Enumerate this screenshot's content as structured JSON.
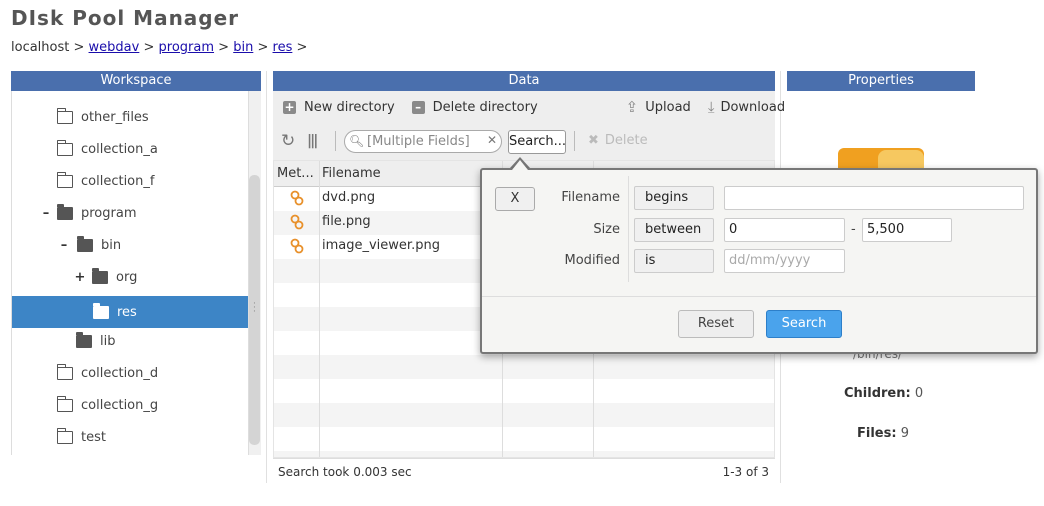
{
  "app": {
    "title": "DIsk Pool Manager"
  },
  "breadcrumb": {
    "root": "localhost",
    "sep": ">",
    "links": [
      "webdav",
      "program",
      "bin",
      "res"
    ]
  },
  "panels": {
    "workspace": "Workspace",
    "data": "Data",
    "properties": "Properties"
  },
  "workspace": {
    "items": [
      {
        "label": "other_files",
        "toggle": "",
        "state": "closed"
      },
      {
        "label": "collection_a",
        "toggle": "",
        "state": "closed"
      },
      {
        "label": "collection_f",
        "toggle": "",
        "state": "closed"
      },
      {
        "label": "program",
        "toggle": "–",
        "state": "open"
      },
      {
        "label": "bin",
        "toggle": "–",
        "state": "open"
      },
      {
        "label": "org",
        "toggle": "+",
        "state": "open"
      },
      {
        "label": "res",
        "toggle": "",
        "state": "open",
        "selected": true
      },
      {
        "label": "lib",
        "toggle": "",
        "state": "open"
      },
      {
        "label": "collection_d",
        "toggle": "",
        "state": "closed"
      },
      {
        "label": "collection_g",
        "toggle": "",
        "state": "closed"
      },
      {
        "label": "test",
        "toggle": "",
        "state": "closed"
      }
    ]
  },
  "toolbar": {
    "new_directory": "New directory",
    "delete_directory": "Delete directory",
    "upload": "Upload",
    "download": "Download",
    "search_placeholder": "[Multiple Fields]",
    "search_button": "Search...",
    "delete": "Delete"
  },
  "grid": {
    "columns": [
      "Met...",
      "Filename"
    ],
    "rows": [
      {
        "filename": "dvd.png"
      },
      {
        "filename": "file.png"
      },
      {
        "filename": "image_viewer.png"
      }
    ],
    "footer_left": "Search took 0.003 sec",
    "footer_right": "1-3 of 3"
  },
  "properties": {
    "path": "/bin/res/",
    "children_label": "Children:",
    "children_value": "0",
    "files_label": "Files:",
    "files_value": "9"
  },
  "search_popup": {
    "close": "X",
    "filename_label": "Filename",
    "filename_op": "begins",
    "filename_value": "",
    "size_label": "Size",
    "size_op": "between",
    "size_min": "0",
    "size_dash": "-",
    "size_max": "5,500",
    "modified_label": "Modified",
    "modified_op": "is",
    "modified_placeholder": "dd/mm/yyyy",
    "reset": "Reset",
    "search": "Search"
  },
  "colors": {
    "header_blue": "#4a6fad",
    "selected_blue": "#3d85c6",
    "search_blue": "#4aa3ec",
    "folder_orange": "#f0a020"
  }
}
